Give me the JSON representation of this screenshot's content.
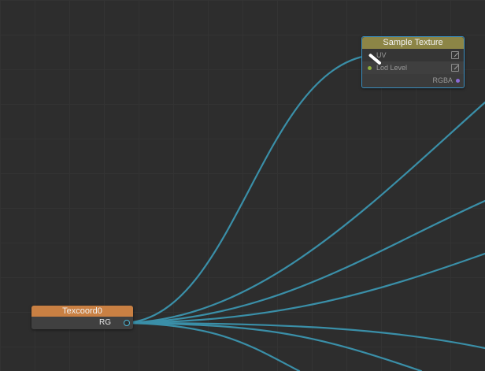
{
  "graph": {
    "wire_color": "#3a8fa8",
    "background_color": "#2d2d2d"
  },
  "nodes": {
    "sample_texture": {
      "title": "Sample Texture",
      "header_color": "#8c8546",
      "selected_border_color": "#3a8fc0",
      "inputs": [
        {
          "label": "UV",
          "icon": "edit-icon"
        },
        {
          "label": "Lod Level",
          "icon": "edit-icon",
          "port_color": "#8fae3c"
        }
      ],
      "outputs": [
        {
          "label": "RGBA",
          "port_color": "#8b6ad8"
        }
      ]
    },
    "texcoord0": {
      "title": "Texcoord0",
      "header_color": "#c98043",
      "outputs": [
        {
          "label": "RG",
          "port_color": "#4fb7d6"
        }
      ]
    }
  }
}
